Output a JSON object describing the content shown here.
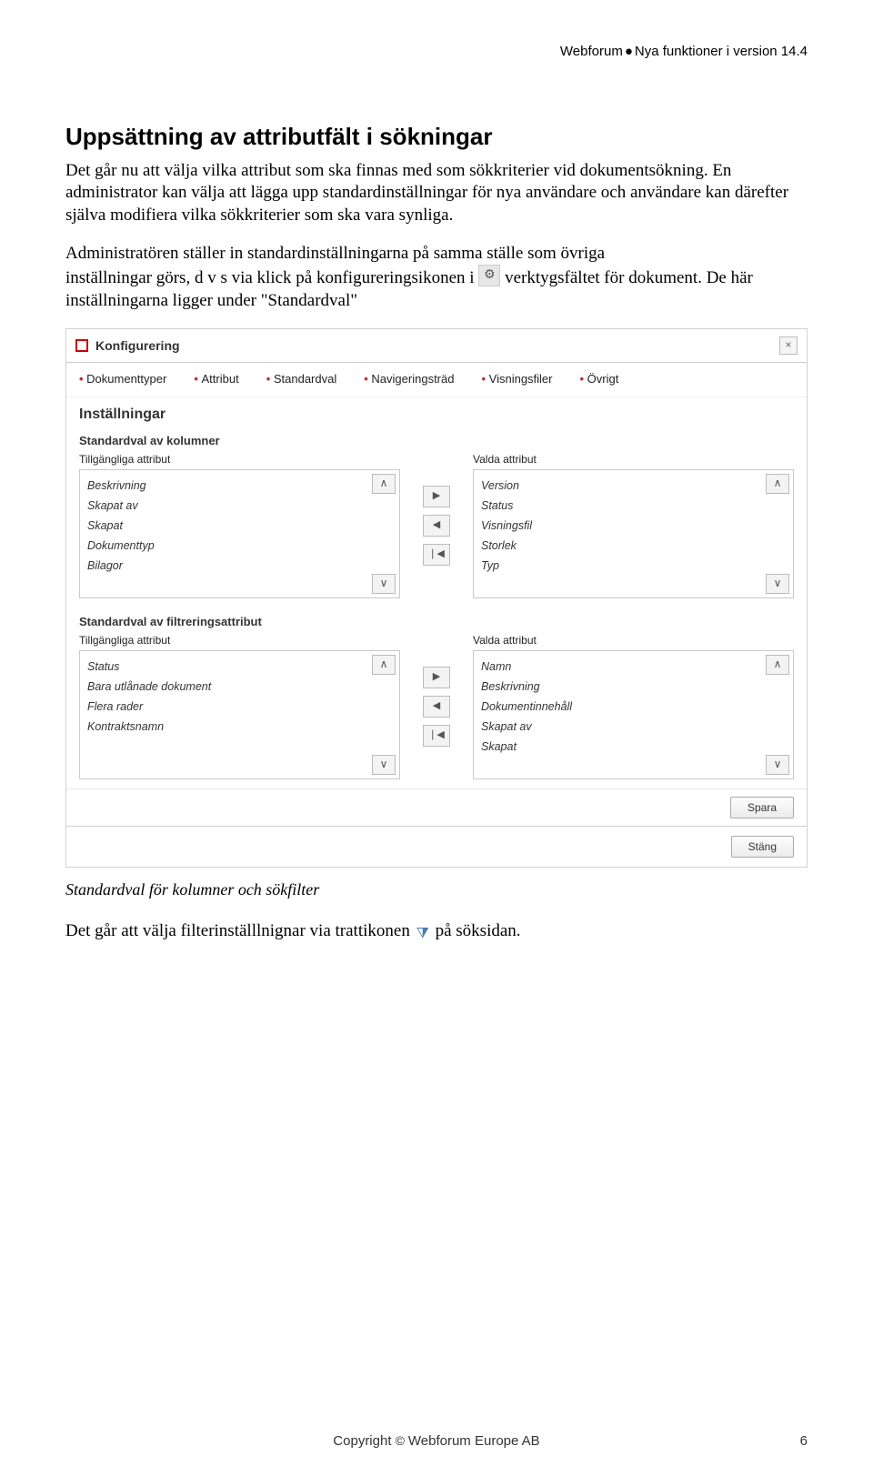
{
  "header": {
    "product": "Webforum",
    "subtitle": "Nya funktioner i version 14.4"
  },
  "section": {
    "title": "Uppsättning av attributfält i sökningar",
    "p1": "Det går nu att välja vilka attribut som ska finnas med som sökkriterier vid dokumentsökning. En administrator kan välja att lägga upp standardinställningar för nya användare och användare kan därefter själva modifiera vilka sökkriterier som ska vara synliga.",
    "p2": "Administratören ställer in standardinställningarna på samma ställe som övriga",
    "p3a": "inställningar görs, d v s via klick på konfigureringsikonen i ",
    "p3b": " verktygsfältet för dokument. De här inställningarna ligger under \"Standardval\""
  },
  "screenshot": {
    "window_title": "Konfigurering",
    "tabs": [
      "Dokumenttyper",
      "Attribut",
      "Standardval",
      "Navigeringsträd",
      "Visningsfiler",
      "Övrigt"
    ],
    "settings_heading": "Inställningar",
    "block1": {
      "title": "Standardval av kolumner",
      "left_label": "Tillgängliga attribut",
      "right_label": "Valda attribut",
      "left": [
        "Beskrivning",
        "Skapat av",
        "Skapat",
        "Dokumenttyp",
        "Bilagor"
      ],
      "right": [
        "Version",
        "Status",
        "Visningsfil",
        "Storlek",
        "Typ"
      ]
    },
    "block2": {
      "title": "Standardval av filtreringsattribut",
      "left_label": "Tillgängliga attribut",
      "right_label": "Valda attribut",
      "left": [
        "Status",
        "Bara utlånade dokument",
        "Flera rader",
        "Kontraktsnamn"
      ],
      "right": [
        "Namn",
        "Beskrivning",
        "Dokumentinnehåll",
        "Skapat av",
        "Skapat"
      ]
    },
    "save": "Spara",
    "close": "Stäng"
  },
  "caption": "Standardval för kolumner och sökfilter",
  "filter_sentence": {
    "a": "Det går att välja filterinställlnignar via trattikonen ",
    "b": " på söksidan."
  },
  "footer": {
    "copyright": "Copyright",
    "company": "Webforum Europe AB",
    "page": "6"
  }
}
